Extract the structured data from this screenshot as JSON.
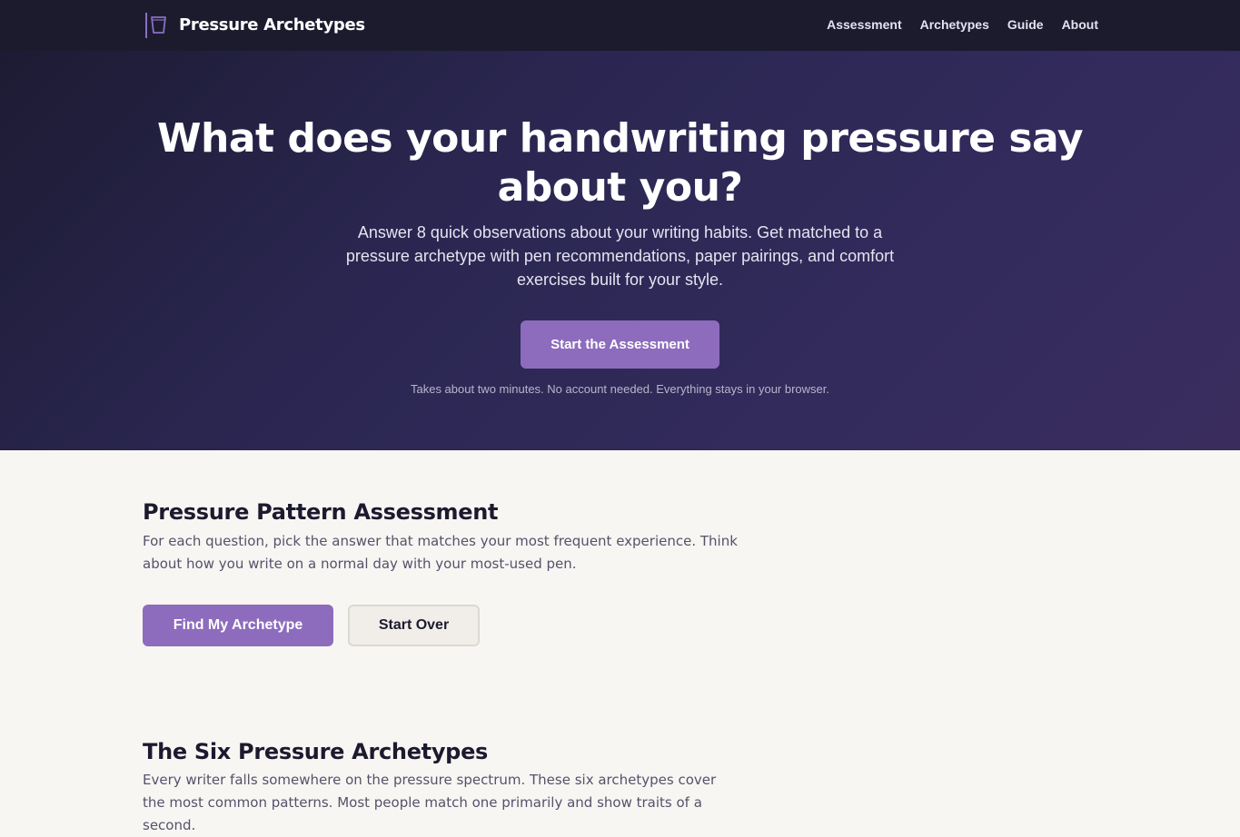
{
  "header": {
    "brand": "Pressure Archetypes",
    "brand_icon": "cup-icon",
    "nav": [
      "Assessment",
      "Archetypes",
      "Guide",
      "About"
    ]
  },
  "hero": {
    "title": "What does your handwriting pressure say about you?",
    "lede": "Answer 8 quick observations about your writing habits. Get matched to a pressure archetype with pen recommendations, paper pairings, and comfort exercises built for your style.",
    "cta": "Start the Assessment",
    "note": "Takes about two minutes. No account needed. Everything stays in your browser."
  },
  "assessment": {
    "title": "Pressure Pattern Assessment",
    "text": "For each question, pick the answer that matches your most frequent experience. Think about how you write on a normal day with your most-used pen.",
    "primary_button": "Find My Archetype",
    "secondary_button": "Start Over"
  },
  "archetypes": {
    "title": "The Six Pressure Archetypes",
    "text": "Every writer falls somewhere on the pressure spectrum. These six archetypes cover the most common patterns. Most people match one primarily and show traits of a second."
  },
  "colors": {
    "accent": "#8d6cbd",
    "header_bg": "#1c1b2e",
    "page_bg": "#f8f6f3"
  }
}
